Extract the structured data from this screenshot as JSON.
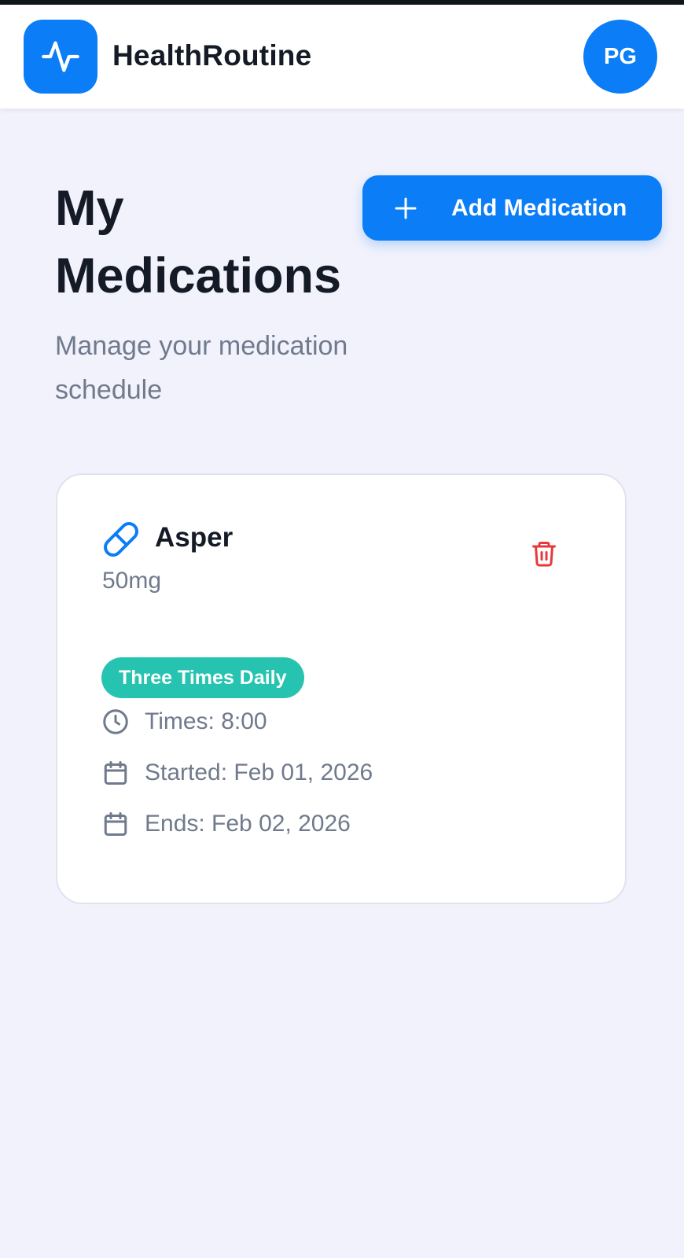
{
  "header": {
    "brand_name": "HealthRoutine",
    "logo_icon": "activity-pulse-icon",
    "avatar_initials": "PG",
    "accent_color": "#0a7df7"
  },
  "page": {
    "title": "My Medications",
    "subtitle": "Manage your medication schedule",
    "add_button_label": "Add Medication",
    "add_button_icon": "plus-icon"
  },
  "medications": [
    {
      "name": "Asper",
      "dose": "50mg",
      "icon": "pill-icon",
      "frequency": "Three Times Daily",
      "frequency_color": "#26c4b0",
      "times": "Times: 8:00",
      "started": "Started: Feb 01, 2026",
      "ends": "Ends: Feb 02, 2026",
      "delete_icon": "trash-icon",
      "delete_color": "#e5393c"
    }
  ]
}
